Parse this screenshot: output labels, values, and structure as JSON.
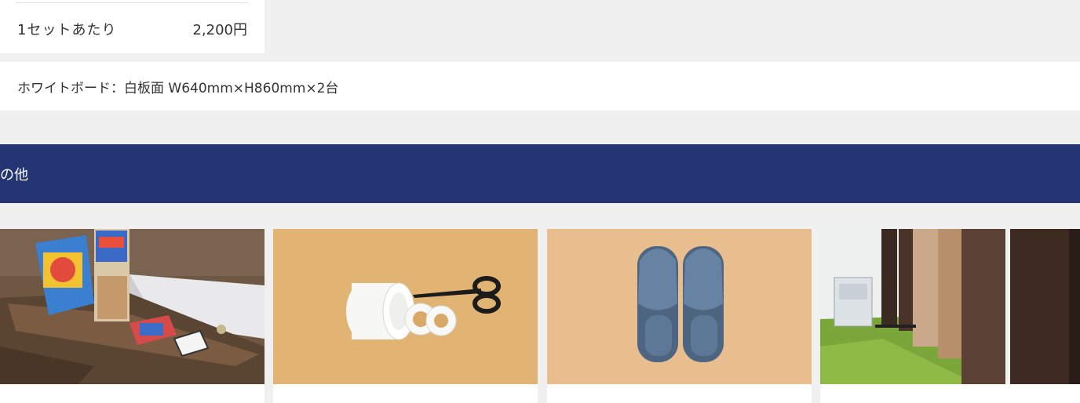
{
  "price_card": {
    "label": "1セットあたり",
    "value": "2,200円"
  },
  "note": {
    "text": "ホワイトボード：白板面 W640mm×H860mm×2台"
  },
  "section": {
    "title": "の他"
  },
  "colors": {
    "banner": "#233673",
    "background": "#f0f0f0",
    "card": "#ffffff"
  },
  "cards": [
    {
      "icon": "board-games-photo"
    },
    {
      "icon": "tape-scissors-photo"
    },
    {
      "icon": "slippers-photo"
    },
    {
      "icon": "partition-screens-photo"
    }
  ]
}
